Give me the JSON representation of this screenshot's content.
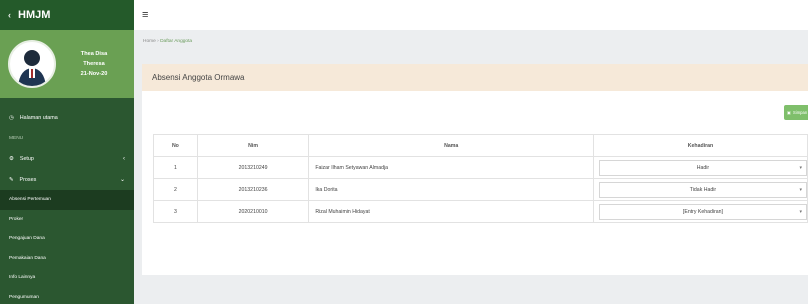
{
  "app": {
    "brand": "HMJM"
  },
  "profile": {
    "name": "Thea Disa",
    "subtitle": "Theresa",
    "date": "21-Nov-20"
  },
  "sidebar": {
    "home": "Halaman utama",
    "header": "MENU",
    "setup": "Setup",
    "proses": "Proses",
    "subitems": [
      "Absensi Pertemuan",
      "Proker",
      "Pengajuan Dana",
      "Pemakaian Dana",
      "Info Lainnya",
      "Pengumuman"
    ]
  },
  "topbar": {
    "menu_icon": "≡"
  },
  "breadcrumb": {
    "home": "Home",
    "sep": "›",
    "current": "Daftar Anggota"
  },
  "panel": {
    "title": "Absensi Anggota Ormawa",
    "save_label": "Simpan"
  },
  "table": {
    "headers": {
      "no": "No",
      "nim": "Nim",
      "nama": "Nama",
      "kehadiran": "Kehadiran"
    },
    "rows": [
      {
        "no": "1",
        "nim": "2013210249",
        "nama": "Faizar Ilham Setyawan Almadja",
        "kehadiran": "Hadir"
      },
      {
        "no": "2",
        "nim": "2013210236",
        "nama": "Ika Dorita",
        "kehadiran": "Tidak Hadir"
      },
      {
        "no": "3",
        "nim": "2020210010",
        "nama": "Rizal Muhaimin Hidayat",
        "kehadiran": "[Entry Kehadiran]"
      }
    ]
  }
}
